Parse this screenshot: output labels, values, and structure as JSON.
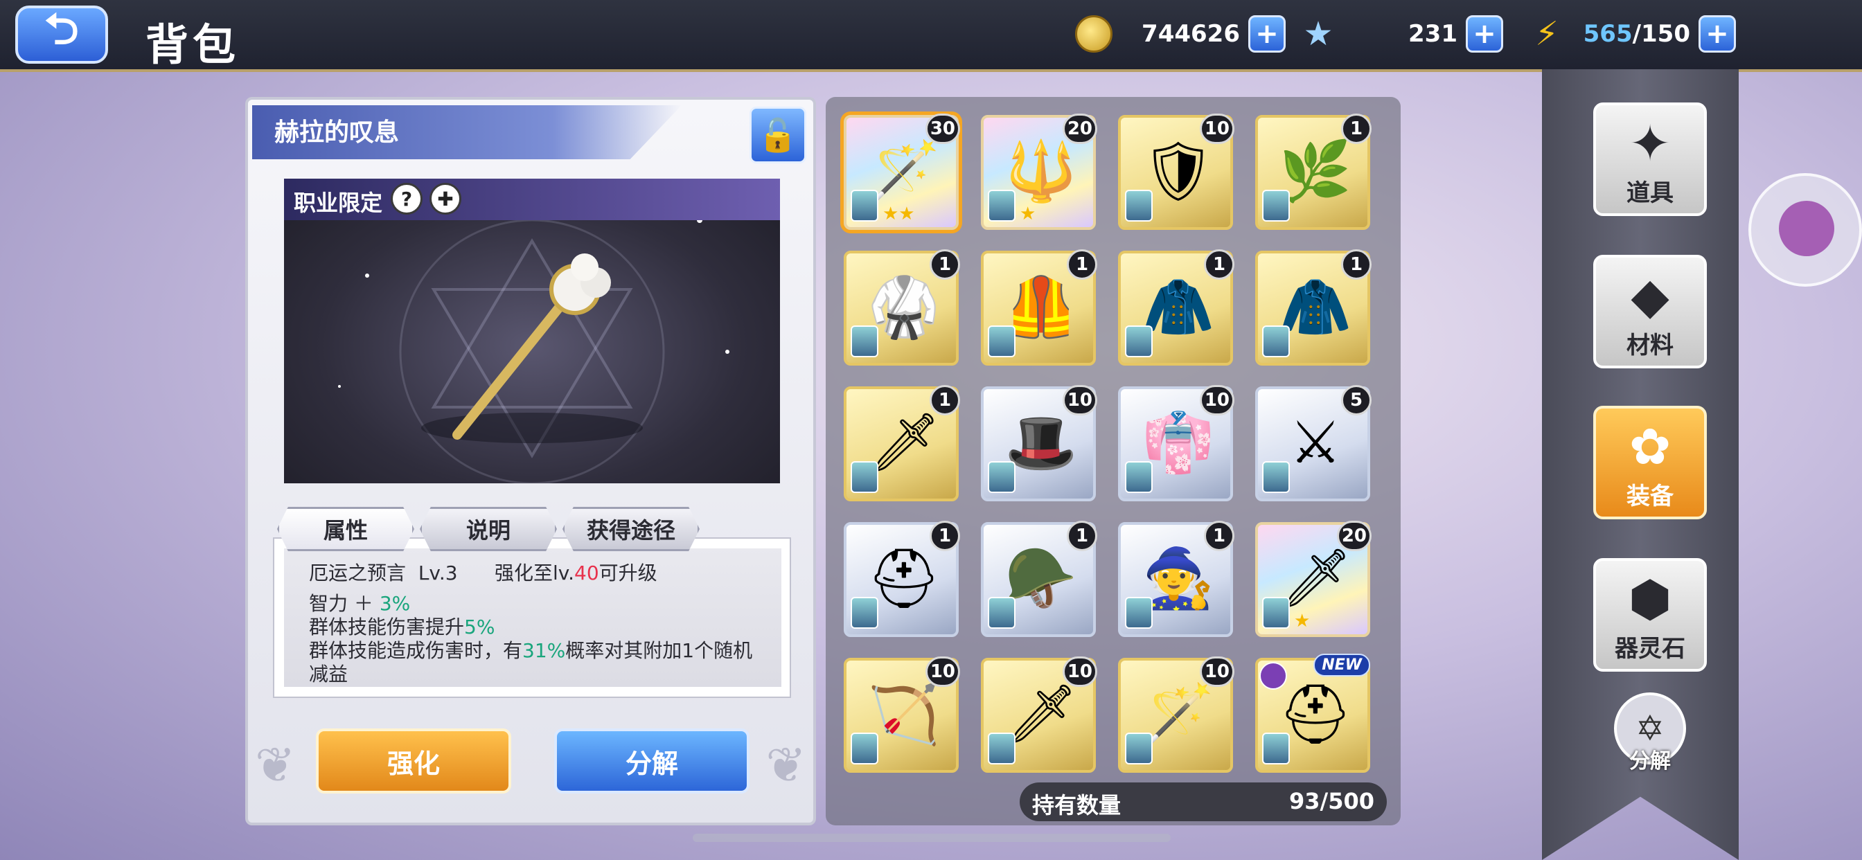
{
  "header": {
    "back_icon": "⮌",
    "title": "背包"
  },
  "resources": {
    "gold": "744626",
    "stars": "231",
    "stamina_current": "565",
    "stamina_max": "/150",
    "plus": "+"
  },
  "detail": {
    "item_name": "赫拉的叹息",
    "lock_icon": "🔓",
    "class_restriction_label": "职业限定",
    "tabs": [
      "属性",
      "说明",
      "获得途径"
    ],
    "skill_name": "厄运之预言",
    "skill_level": "Lv.3",
    "upgrade_prefix": "强化至lv.",
    "upgrade_level": "40",
    "upgrade_suffix": "可升级",
    "stat1_label": "智力 ＋",
    "stat1_value": "3%",
    "stat2_label": "群体技能伤害提升",
    "stat2_value": "5%",
    "stat3_prefix": "群体技能造成伤害时，有",
    "stat3_value": "31%",
    "stat3_suffix": "概率对其附加1个随机",
    "stat3_line2": "减益",
    "enhance_label": "强化",
    "decompose_label": "分解"
  },
  "grid": {
    "items": [
      {
        "count": "30",
        "art": "🪄",
        "frame": "rainbow",
        "stars": "★★",
        "selected": true
      },
      {
        "count": "20",
        "art": "🔱",
        "frame": "rainbow",
        "stars": "★"
      },
      {
        "count": "10",
        "art": "🛡",
        "frame": "gold",
        "stars": ""
      },
      {
        "count": "1",
        "art": "🌿",
        "frame": "gold",
        "stars": ""
      },
      {
        "count": "1",
        "art": "🥋",
        "frame": "gold",
        "stars": ""
      },
      {
        "count": "1",
        "art": "🦺",
        "frame": "gold",
        "stars": ""
      },
      {
        "count": "1",
        "art": "🧥",
        "frame": "gold",
        "stars": ""
      },
      {
        "count": "1",
        "art": "🧥",
        "frame": "gold",
        "stars": ""
      },
      {
        "count": "1",
        "art": "🗡",
        "frame": "gold",
        "stars": ""
      },
      {
        "count": "10",
        "art": "🎩",
        "frame": "silver",
        "stars": ""
      },
      {
        "count": "10",
        "art": "👘",
        "frame": "silver",
        "stars": ""
      },
      {
        "count": "5",
        "art": "⚔",
        "frame": "silver",
        "stars": ""
      },
      {
        "count": "1",
        "art": "⛑",
        "frame": "silver",
        "stars": ""
      },
      {
        "count": "1",
        "art": "🪖",
        "frame": "silver",
        "stars": ""
      },
      {
        "count": "1",
        "art": "🧙",
        "frame": "silver",
        "stars": ""
      },
      {
        "count": "20",
        "art": "🗡",
        "frame": "rainbow",
        "stars": "★"
      },
      {
        "count": "10",
        "art": "🏹",
        "frame": "gold",
        "stars": ""
      },
      {
        "count": "10",
        "art": "🗡",
        "frame": "gold",
        "stars": ""
      },
      {
        "count": "10",
        "art": "🪄",
        "frame": "gold",
        "stars": ""
      },
      {
        "count": "",
        "art": "⛑",
        "frame": "gold",
        "stars": "",
        "new": "NEW"
      }
    ],
    "footer_label": "持有数量",
    "footer_value": "93/500"
  },
  "categories": [
    {
      "label": "道具",
      "icon": "✦"
    },
    {
      "label": "材料",
      "icon": "◆"
    },
    {
      "label": "装备",
      "icon": "✿"
    },
    {
      "label": "器灵石",
      "icon": "⬢"
    }
  ],
  "decompose_small_label": "分解",
  "decompose_small_icon": "✡",
  "class_icons": [
    "?",
    "✚"
  ]
}
